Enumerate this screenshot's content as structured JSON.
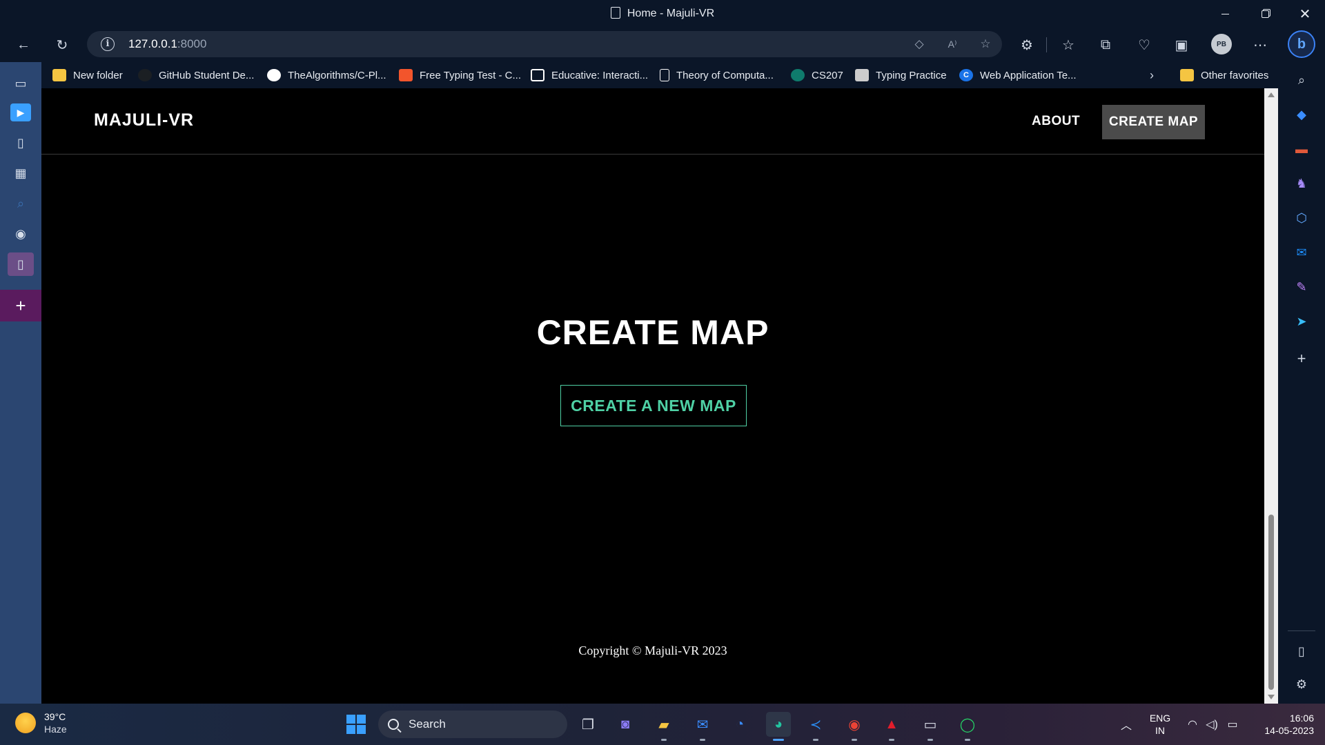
{
  "window": {
    "title": "Home - Majuli-VR",
    "minimize_icon": "minimize-icon",
    "restore_icon": "restore-icon",
    "close_icon": "close-icon"
  },
  "toolbar": {
    "url_host": "127.0.0.1",
    "url_port": ":8000",
    "profile_initials": "PB"
  },
  "favorites": [
    {
      "label": "New folder",
      "icon": "folder-icon",
      "color": "#f5c542"
    },
    {
      "label": "GitHub Student De...",
      "icon": "github-icon",
      "color": "#1b1f23"
    },
    {
      "label": "TheAlgorithms/C-Pl...",
      "icon": "github-icon",
      "color": "#ffffff"
    },
    {
      "label": "Free Typing Test - C...",
      "icon": "typing-icon",
      "color": "#f2552c"
    },
    {
      "label": "Educative: Interacti...",
      "icon": "educative-icon",
      "color": "#ffffff"
    },
    {
      "label": "Theory of Computa...",
      "icon": "page-icon",
      "color": "#ffffff"
    },
    {
      "label": "CS207",
      "icon": "sharepoint-icon",
      "color": "#0f7b6c"
    },
    {
      "label": "Typing Practice",
      "icon": "typing-practice-icon",
      "color": "#cccccc"
    },
    {
      "label": "Web Application Te...",
      "icon": "c-icon",
      "color": "#1a73e8"
    },
    {
      "label": "Other favorites",
      "icon": "folder-icon",
      "color": "#f5c542"
    }
  ],
  "site": {
    "brand": "MAJULI-VR",
    "nav_about": "ABOUT",
    "nav_create": "CREATE MAP",
    "hero_title": "CREATE MAP",
    "create_button": "CREATE A NEW MAP",
    "footer": "Copyright © Majuli-VR 2023",
    "accent": "#4fd1a5"
  },
  "taskbar": {
    "temperature": "39°C",
    "condition": "Haze",
    "search_label": "Search",
    "language": "ENG",
    "region": "IN",
    "time": "16:06",
    "date": "14-05-2023"
  }
}
